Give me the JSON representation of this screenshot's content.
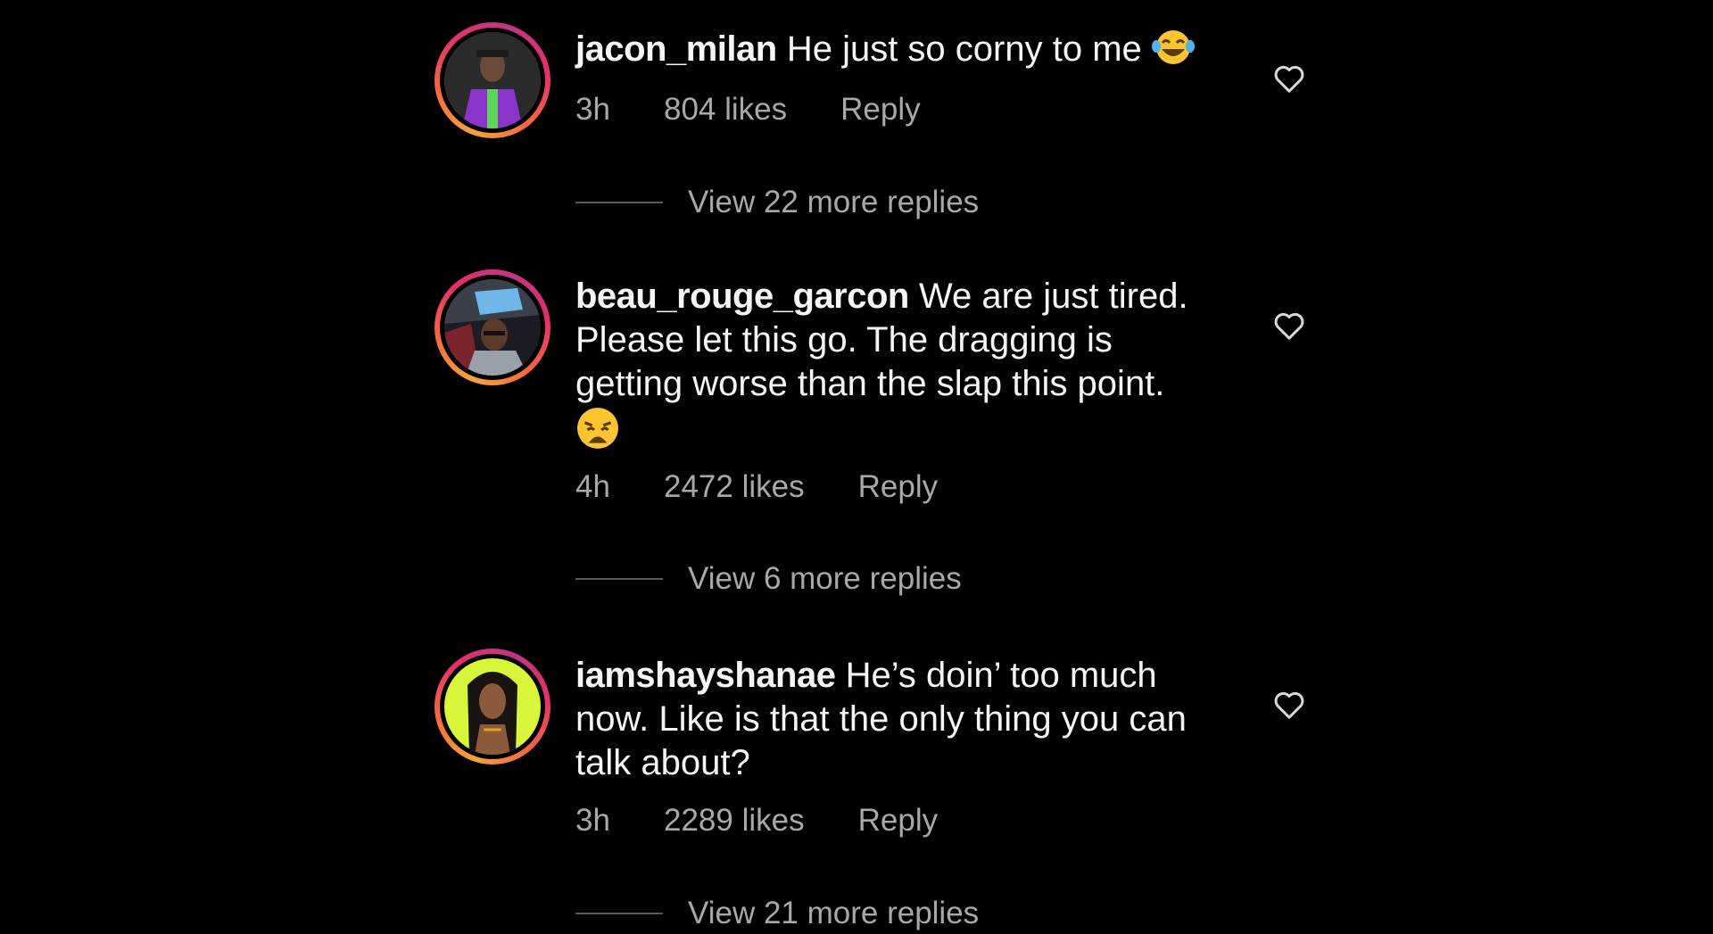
{
  "comments": [
    {
      "username": "jacon_milan",
      "text": "He just so corny to me",
      "emoji": "laughing-tears",
      "time": "3h",
      "likes": "804 likes",
      "reply_label": "Reply",
      "view_replies": "View 22 more replies"
    },
    {
      "username": "beau_rouge_garcon",
      "text": "We are just tired. Please let this go. The dragging is getting worse than the slap this point.",
      "emoji": "weary-face",
      "time": "4h",
      "likes": "2472 likes",
      "reply_label": "Reply",
      "view_replies": "View 6 more replies"
    },
    {
      "username": "iamshayshanae",
      "text": "He’s doin’ too much now. Like is that the only thing you can talk about?",
      "time": "3h",
      "likes": "2289 likes",
      "reply_label": "Reply",
      "view_replies": "View 21 more replies"
    }
  ],
  "colors": {
    "background": "#000000",
    "text": "#f5f5f5",
    "secondary": "#a8a8a8"
  }
}
